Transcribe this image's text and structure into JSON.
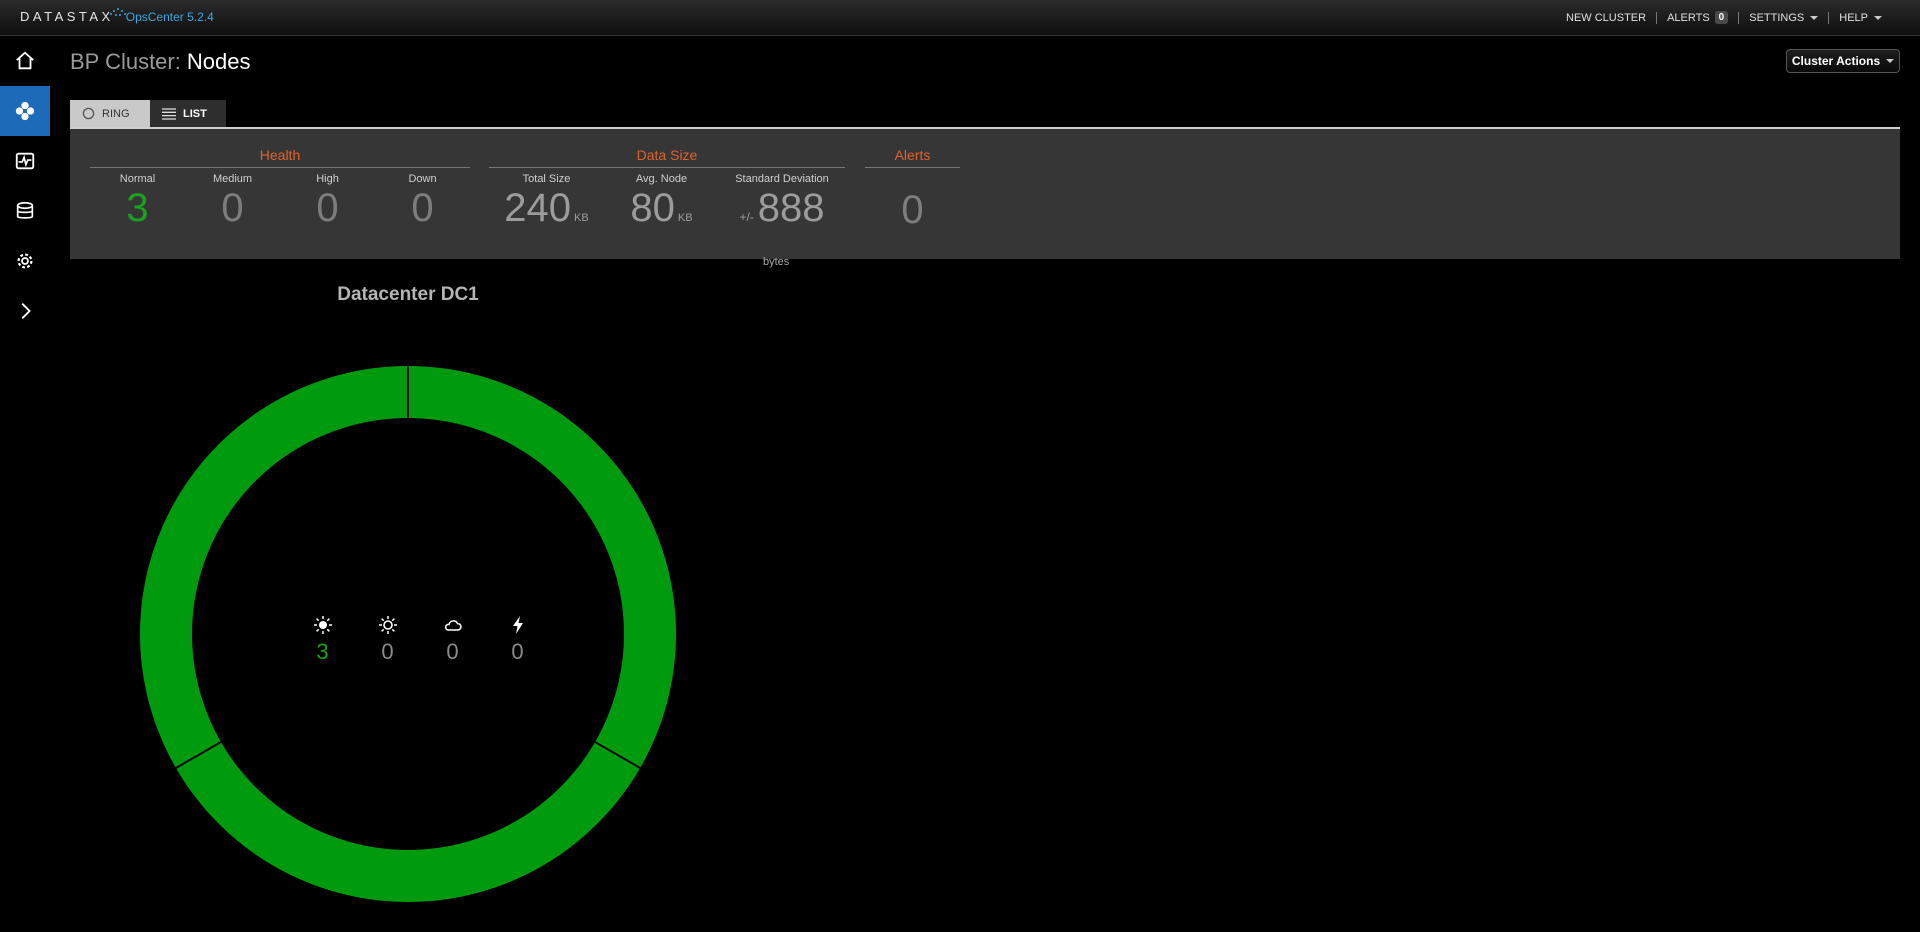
{
  "brand": {
    "name": "DATASTAX",
    "product": "OpsCenter 5.2.4"
  },
  "topnav": {
    "new_cluster": "NEW CLUSTER",
    "alerts_label": "ALERTS",
    "alerts_count": "0",
    "settings": "SETTINGS",
    "help": "HELP"
  },
  "sidebar": {
    "items": [
      {
        "icon": "home-icon"
      },
      {
        "icon": "cluster-nodes-icon",
        "active": true
      },
      {
        "icon": "activity-monitor-icon"
      },
      {
        "icon": "database-icon"
      },
      {
        "icon": "gear-icon"
      },
      {
        "icon": "chevron-right-icon"
      }
    ]
  },
  "page": {
    "title_prefix": "BP Cluster:",
    "title": "Nodes",
    "cluster_actions": "Cluster Actions"
  },
  "tabs": {
    "ring": "RING",
    "list": "LIST"
  },
  "health": {
    "title": "Health",
    "normal_label": "Normal",
    "normal_value": "3",
    "medium_label": "Medium",
    "medium_value": "0",
    "high_label": "High",
    "high_value": "0",
    "down_label": "Down",
    "down_value": "0"
  },
  "data_size": {
    "title": "Data Size",
    "total_label": "Total Size",
    "total_value": "240",
    "total_unit": "KB",
    "avg_label": "Avg. Node",
    "avg_value": "80",
    "avg_unit": "KB",
    "stddev_label": "Standard Deviation",
    "stddev_prefix": "+/-",
    "stddev_value": "888",
    "stddev_unit": "bytes"
  },
  "alerts": {
    "title": "Alerts",
    "value": "0"
  },
  "datacenter": {
    "title": "Datacenter DC1",
    "ring_color": "#009a0e",
    "nodes": 3,
    "stats": [
      {
        "icon": "sun-icon",
        "value": "3"
      },
      {
        "icon": "partly-sunny-icon",
        "value": "0"
      },
      {
        "icon": "cloud-icon",
        "value": "0"
      },
      {
        "icon": "lightning-icon",
        "value": "0"
      }
    ]
  },
  "colors": {
    "accent": "#1d6ab8",
    "health_title": "#e0622b",
    "normal": "#1aa31a"
  }
}
